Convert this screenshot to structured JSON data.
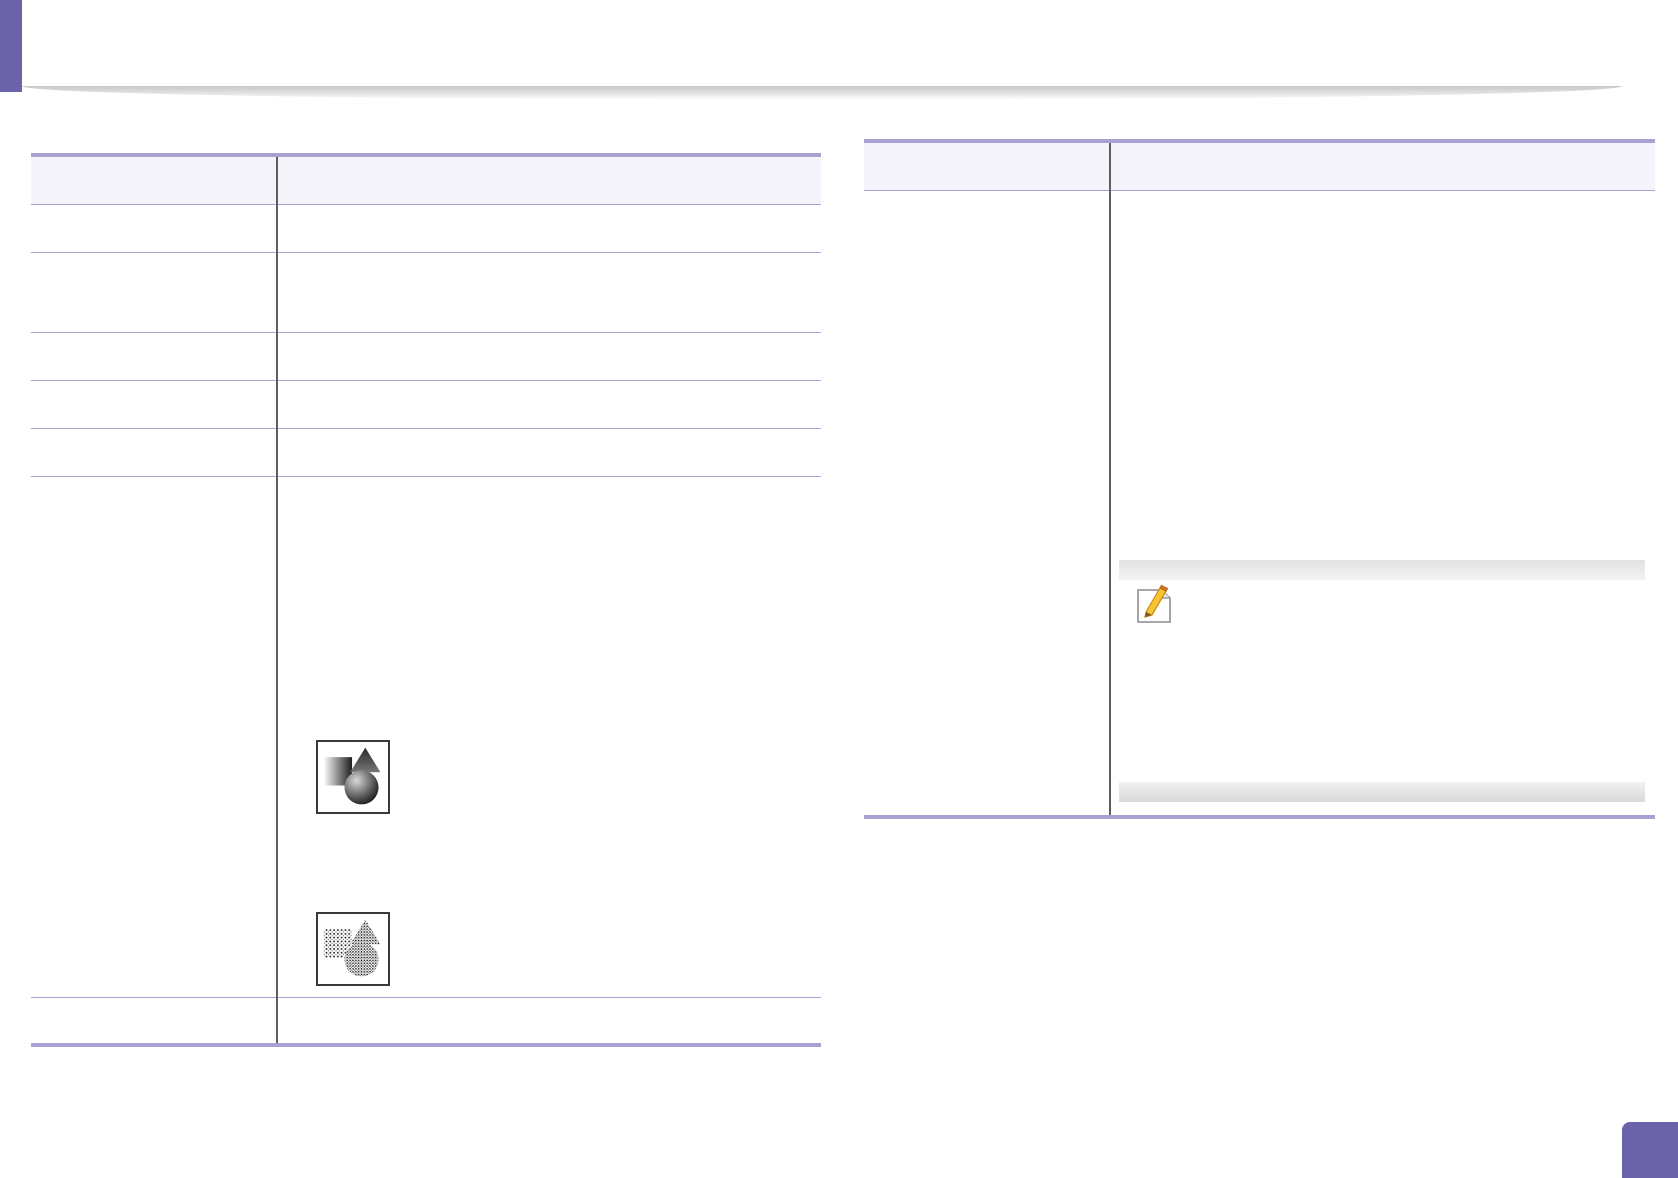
{
  "colors": {
    "accent": "#6b63aa",
    "rule": "#a7a2d2",
    "header_fill": "#f5f4fa"
  },
  "icons": {
    "note": "note-pencil-icon",
    "image_sample_1": "shapes-solid-icon",
    "image_sample_2": "shapes-dithered-icon"
  }
}
